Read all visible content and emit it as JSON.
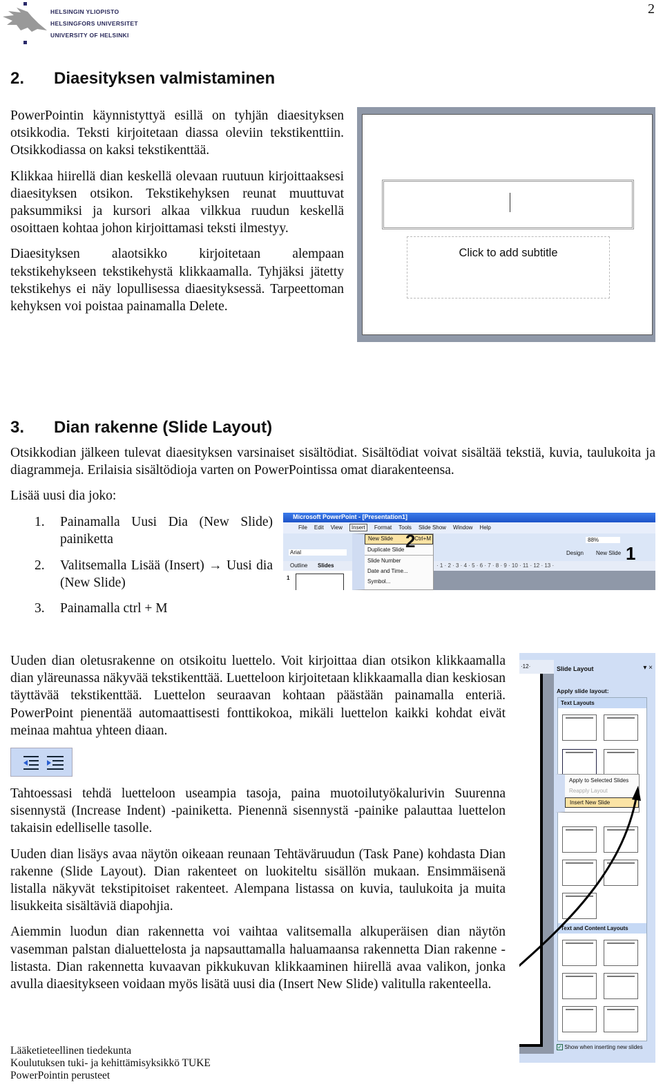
{
  "page_number": "2",
  "logo": {
    "lines": [
      "HELSINGIN YLIOPISTO",
      "HELSINGFORS UNIVERSITET",
      "UNIVERSITY OF HELSINKI"
    ]
  },
  "section2": {
    "number": "2.",
    "title": "Diaesityksen valmistaminen",
    "paragraphs": [
      "PowerPointin käynnistyttyä esillä on tyhjän diaesityksen otsikkodia. Teksti kirjoitetaan diassa oleviin tekstikenttiin. Otsikkodiassa on kaksi tekstikenttää.",
      "Klikkaa hiirellä dian keskellä olevaan ruutuun kirjoittaaksesi diaesityksen otsikon. Tekstikehyksen reunat muuttuvat paksummiksi ja kursori alkaa vilkkua ruudun keskellä osoittaen kohtaa johon kirjoittamasi teksti ilmestyy.",
      "Diaesityksen alaotsikko kirjoitetaan alempaan tekstikehykseen tekstikehystä klikkaamalla. Tyhjäksi jätetty tekstikehys ei näy lopullisessa diaesityksessä. Tarpeettoman kehyksen voi poistaa painamalla Delete."
    ],
    "slide": {
      "subtitle_placeholder": "Click to add subtitle"
    }
  },
  "section3": {
    "number": "3.",
    "title": "Dian rakenne (Slide Layout)",
    "intro": "Otsikkodian jälkeen tulevat diaesityksen varsinaiset sisältödiat. Sisältödiat voivat sisältää tekstiä, kuvia, taulukoita ja diagrammeja. Erilaisia sisältödioja varten on PowerPointissa omat diarakenteensa.",
    "list_intro": "Lisää uusi dia joko:",
    "list": [
      {
        "n": "1.",
        "text": "Painamalla Uusi Dia (New Slide) painiketta"
      },
      {
        "n": "2.",
        "text": "Valitsemalla Lisää (Insert) → Uusi dia (New Slide)"
      },
      {
        "n": "3.",
        "text": "Painamalla ctrl + M"
      }
    ],
    "paragraphs": [
      "Uuden dian oletusrakenne on otsikoitu luettelo. Voit kirjoittaa dian otsikon klikkaamalla dian yläreunassa näkyvää tekstikenttää. Luetteloon kirjoitetaan klikkaamalla dian keskiosan täyttävää tekstikenttää. Luettelon seuraavan kohtaan päästään painamalla enteriä. PowerPoint pienentää automaattisesti fonttikokoa, mikäli luettelon kaikki kohdat eivät meinaa mahtua yhteen diaan.",
      "Tahtoessasi tehdä luetteloon useampia tasoja, paina muotoilutyökalurivin Suurenna sisennystä (Increase Indent) -painiketta. Pienennä sisennystä -painike palauttaa luettelon takaisin edelliselle tasolle.",
      "Uuden dian lisäys avaa näytön oikeaan reunaan Tehtäväruudun (Task Pane) kohdasta Dian rakenne (Slide Layout). Dian rakenteet on luokiteltu sisällön mukaan. Ensimmäisenä listalla näkyvät tekstipitoiset rakenteet. Alempana listassa on kuvia, taulukoita ja muita lisukkeita sisältäviä diapohjia.",
      "Aiemmin luodun dian rakennetta voi vaihtaa valitsemalla alkuperäisen dian näytön vasemman palstan dialuettelosta ja napsauttamalla haluamaansa rakennetta Dian rakenne -listasta. Dian rakennetta kuvaavan pikkukuvan klikkaaminen hiirellä avaa valikon, jonka avulla diaesitykseen voidaan myös lisätä uusi dia (Insert New Slide) valitulla rakenteella."
    ],
    "ppt": {
      "title": "Microsoft PowerPoint - [Presentation1]",
      "menu": [
        "File",
        "Edit",
        "View",
        "Insert",
        "Format",
        "Tools",
        "Slide Show",
        "Window",
        "Help"
      ],
      "insert_menu": [
        "New Slide",
        "Duplicate Slide",
        "Slide Number",
        "Date and Time...",
        "Symbol..."
      ],
      "shortcut": "Ctrl+M",
      "font": "Arial",
      "zoom": "88%",
      "design": "Design",
      "new_slide": "New Slide",
      "tabs": [
        "Outline",
        "Slides"
      ],
      "slide_no": "1",
      "callout1": "1",
      "callout2": "2",
      "ruler": "· 1 · 2 · 3 · 4 · 5 · 6 · 7 · 8 · 9 · 10 · 11 · 12 · 13 ·"
    },
    "taskpane": {
      "ruler": "·12·",
      "title": "Slide Layout",
      "apply": "Apply slide layout:",
      "text_layouts": "Text Layouts",
      "context_menu": [
        "Apply to Selected Slides",
        "Reapply Layout",
        "Insert New Slide"
      ],
      "text_content_layouts": "Text and Content Layouts",
      "checkbox": "Show when inserting new slides",
      "checked": true
    }
  },
  "footer": [
    "Lääketieteellinen tiedekunta",
    "Koulutuksen tuki- ja kehittämisyksikkö TUKE",
    "PowerPointin perusteet"
  ],
  "colors": {
    "xp_blue": "#2a5fd0",
    "menu_highlight": "#fbe3a4",
    "panel_blue": "#c6d9f5"
  }
}
